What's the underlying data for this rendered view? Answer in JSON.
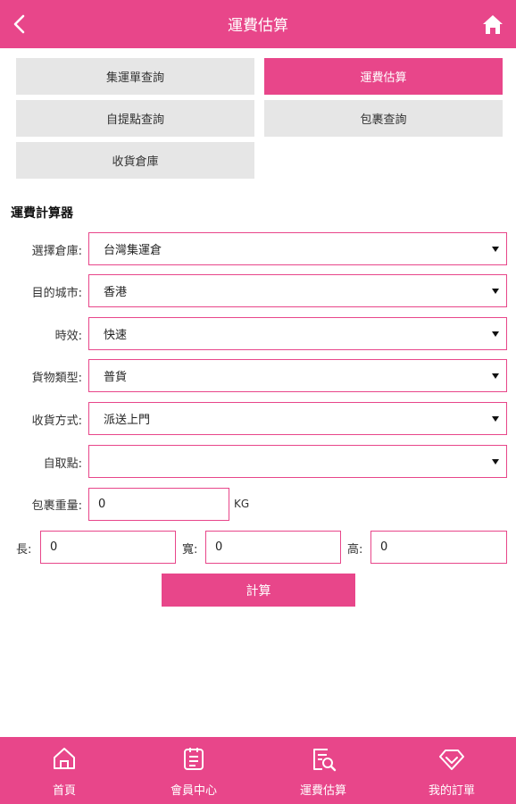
{
  "header": {
    "title": "運費估算",
    "back_icon": "back-chevron-icon",
    "home_icon": "home-icon"
  },
  "tabs": [
    {
      "label": "集運單查詢",
      "active": false
    },
    {
      "label": "運費估算",
      "active": true
    },
    {
      "label": "自提點查詢",
      "active": false
    },
    {
      "label": "包裹查詢",
      "active": false
    },
    {
      "label": "收貨倉庫",
      "active": false
    }
  ],
  "calculator": {
    "title": "運費計算器",
    "warehouse": {
      "label": "選擇倉庫:",
      "value": "台灣集運倉"
    },
    "city": {
      "label": "目的城市:",
      "value": "香港"
    },
    "speed": {
      "label": "時效:",
      "value": "快速"
    },
    "goods_type": {
      "label": "貨物類型:",
      "value": "普貨"
    },
    "delivery_method": {
      "label": "收貨方式:",
      "value": "派送上門"
    },
    "pickup_point": {
      "label": "自取點:",
      "value": ""
    },
    "weight": {
      "label": "包裹重量:",
      "value": "0",
      "unit": "KG"
    },
    "length": {
      "label": "長:",
      "value": "0"
    },
    "width": {
      "label": "寬:",
      "value": "0"
    },
    "height": {
      "label": "高:",
      "value": "0"
    },
    "submit_label": "計算"
  },
  "bottom_nav": [
    {
      "label": "首頁",
      "icon": "home-outline-icon"
    },
    {
      "label": "會員中心",
      "icon": "clipboard-icon"
    },
    {
      "label": "運費估算",
      "icon": "calculator-search-icon"
    },
    {
      "label": "我的訂單",
      "icon": "diamond-icon"
    }
  ],
  "colors": {
    "accent": "#e8468a",
    "tab_inactive": "#e6e6e6",
    "text": "#222222"
  }
}
